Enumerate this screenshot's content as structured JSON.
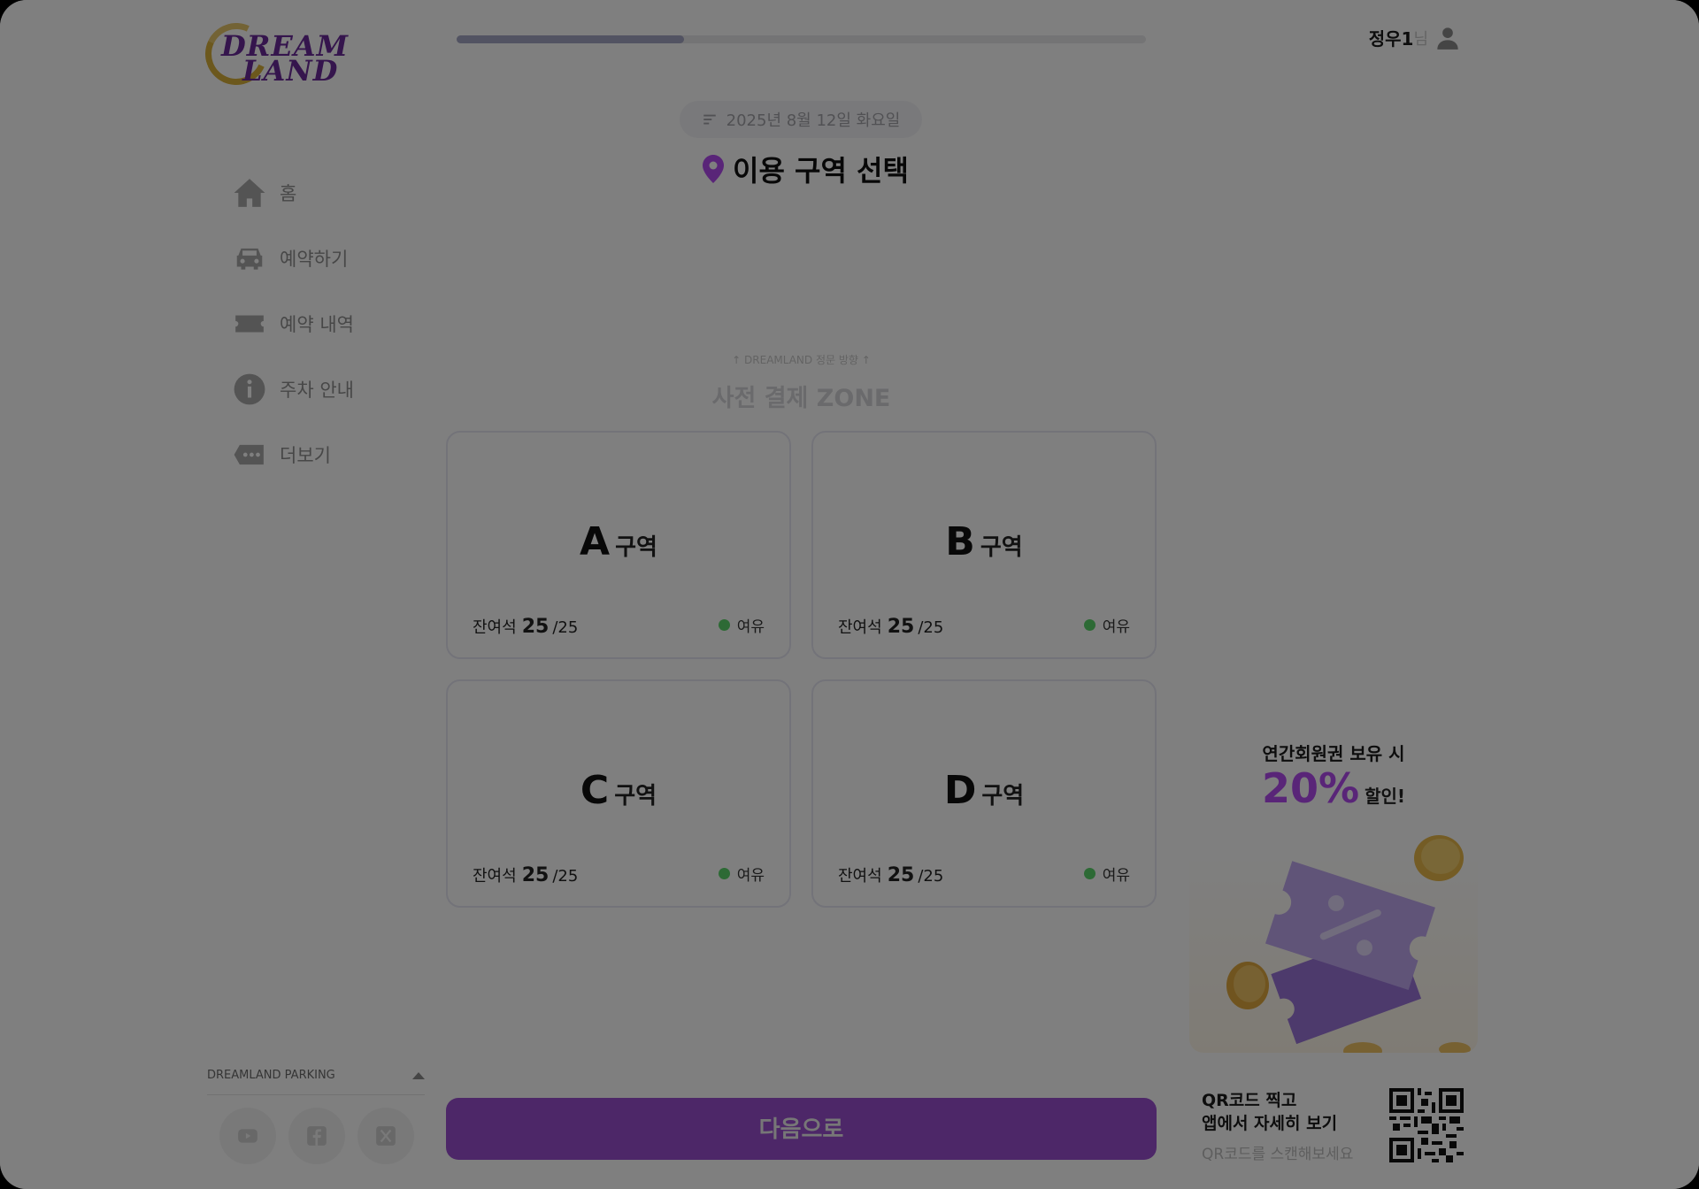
{
  "header": {
    "logo_line1": "DREAM",
    "logo_line2": "LAND",
    "progress_fraction": 0.33,
    "user_name": "정우1",
    "user_suffix": "님"
  },
  "sidebar": {
    "items": [
      {
        "label": "홈",
        "icon": "home-icon"
      },
      {
        "label": "예약하기",
        "icon": "car-icon"
      },
      {
        "label": "예약 내역",
        "icon": "ticket-icon"
      },
      {
        "label": "주차 안내",
        "icon": "info-icon"
      },
      {
        "label": "더보기",
        "icon": "more-icon"
      }
    ],
    "footer_title": "DREAMLAND PARKING",
    "socials": [
      "youtube-icon",
      "facebook-icon",
      "x-icon"
    ]
  },
  "main": {
    "date": "2025년 8월 12일 화요일",
    "title": "이용 구역 선택",
    "entrance_label": "↑ DREAMLAND 정문 방향 ↑",
    "zone_title": "사전 결제 ZONE",
    "zone_word": "구역",
    "seats_label": "잔여석",
    "zones": [
      {
        "letter": "A",
        "remaining": "25",
        "total": "/25",
        "status": "여유"
      },
      {
        "letter": "B",
        "remaining": "25",
        "total": "/25",
        "status": "여유"
      },
      {
        "letter": "C",
        "remaining": "25",
        "total": "/25",
        "status": "여유"
      },
      {
        "letter": "D",
        "remaining": "25",
        "total": "/25",
        "status": "여유"
      }
    ],
    "next_button": "다음으로"
  },
  "ads": {
    "promo_line1": "연간회원권 보유 시",
    "promo_percent": "20%",
    "promo_discount": "할인!",
    "qr_line1": "QR코드 찍고",
    "qr_line2": "앱에서 자세히 보기",
    "qr_hint": "QR코드를 스캔해보세요"
  },
  "colors": {
    "brand_purple": "#9b4fd0",
    "status_green": "#5bd46a",
    "promo_purple": "#b34bf0",
    "overlay": "rgba(0,0,0,0.5)"
  }
}
